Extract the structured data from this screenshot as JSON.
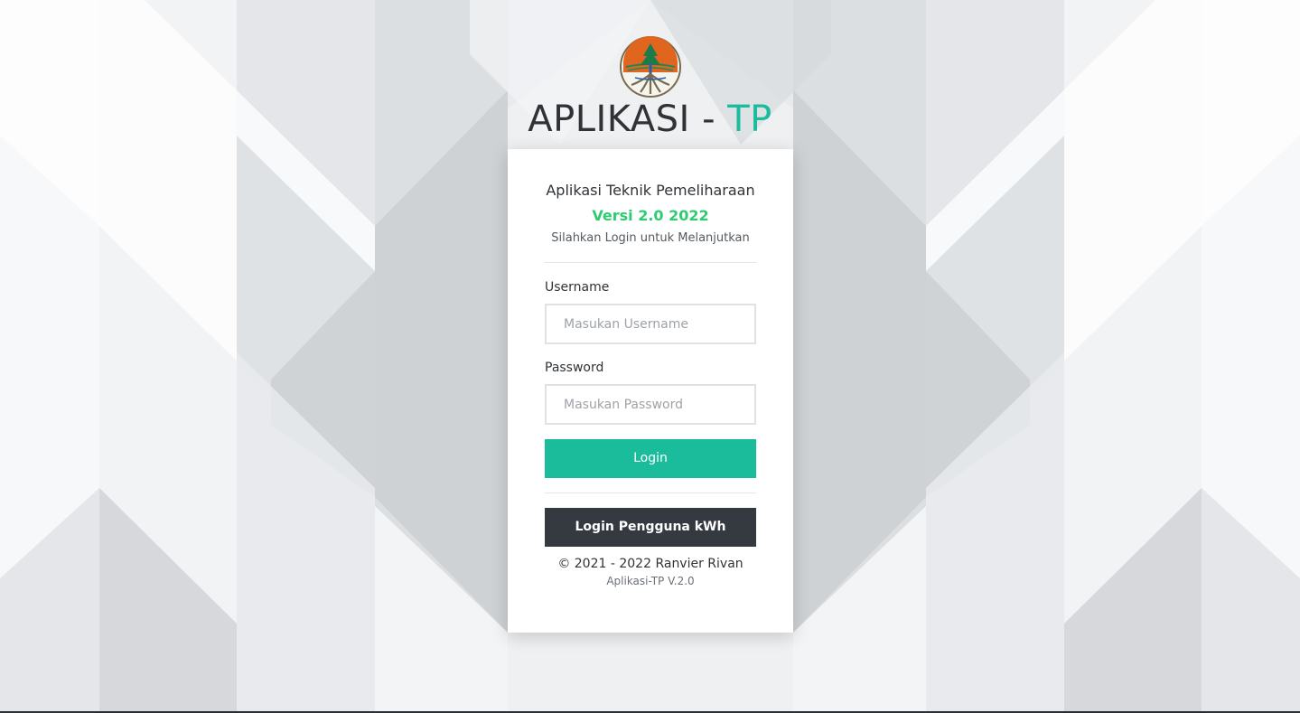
{
  "app": {
    "title_main": "APLIKASI - ",
    "title_accent": "TP"
  },
  "card": {
    "title": "Aplikasi Teknik Pemeliharaan",
    "version": "Versi 2.0 2022",
    "subtitle": "Silahkan Login untuk Melanjutkan"
  },
  "form": {
    "username_label": "Username",
    "username_placeholder": "Masukan Username",
    "username_value": "",
    "password_label": "Password",
    "password_placeholder": "Masukan Password",
    "password_value": "",
    "login_button": "Login",
    "kwh_button": "Login Pengguna kWh"
  },
  "footer": {
    "copyright": "© 2021 - 2022 Ranvier Rivan",
    "app_version": "Aplikasi-TP V.2.0"
  },
  "icons": {
    "logo": "forest-tree-emblem-logo"
  },
  "colors": {
    "accent": "#1abc9c",
    "version_green": "#2ecc71",
    "dark_button": "#343a40",
    "text_dark": "#2f3337"
  }
}
